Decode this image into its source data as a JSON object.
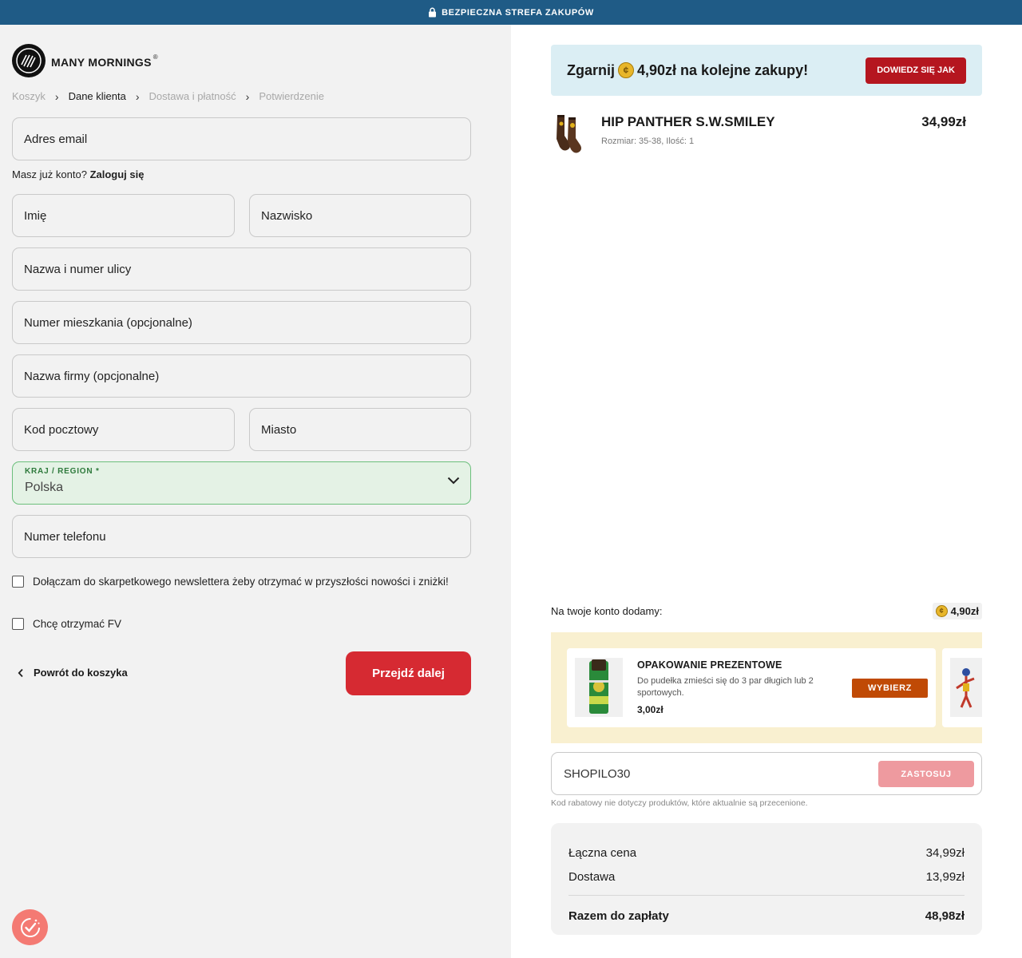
{
  "topbar": {
    "text": "BEZPIECZNA STREFA ZAKUPÓW",
    "icon": "lock-icon"
  },
  "brand": {
    "name": "MANY MORNINGS",
    "mark": "®"
  },
  "breadcrumb": [
    {
      "label": "Koszyk"
    },
    {
      "label": "Dane klienta"
    },
    {
      "label": "Dostawa i płatność"
    },
    {
      "label": "Potwierdzenie"
    }
  ],
  "form": {
    "email": "Adres email",
    "have_account": "Masz już konto?",
    "login": "Zaloguj się",
    "first_name": "Imię",
    "last_name": "Nazwisko",
    "street": "Nazwa i numer ulicy",
    "apartment": "Numer mieszkania (opcjonalne)",
    "company": "Nazwa firmy (opcjonalne)",
    "postal": "Kod pocztowy",
    "city": "Miasto",
    "country_label": "KRAJ / REGION *",
    "country_value": "Polska",
    "phone": "Numer telefonu",
    "newsletter": "Dołączam do skarpetkowego newslettera żeby otrzymać w przyszłości nowości i zniżki!",
    "invoice": "Chcę otrzymać FV",
    "back": "Powrót do koszyka",
    "next": "Przejdź dalej"
  },
  "promo": {
    "prefix": "Zgarnij",
    "text": "4,90zł na kolejne zakupy!",
    "button": "DOWIEDZ SIĘ JAK"
  },
  "cart_item": {
    "name": "HIP PANTHER S.W.SMILEY",
    "meta": "Rozmiar: 35-38, Ilość: 1",
    "price": "34,99zł"
  },
  "account_points": {
    "label": "Na twoje konto dodamy:",
    "value": "4,90zł"
  },
  "upsell": {
    "title": "OPAKOWANIE PREZENTOWE",
    "desc": "Do pudełka zmieści się do 3 par długich lub 2 sportowych.",
    "price": "3,00zł",
    "button": "WYBIERZ"
  },
  "coupon": {
    "value": "SHOPILO30",
    "button": "ZASTOSUJ",
    "note": "Kod rabatowy nie dotyczy produktów, które aktualnie są przecenione."
  },
  "summary": {
    "subtotal_label": "Łączna cena",
    "subtotal": "34,99zł",
    "shipping_label": "Dostawa",
    "shipping": "13,99zł",
    "total_label": "Razem do zapłaty",
    "total": "48,98zł"
  },
  "colors": {
    "topbar": "#1f5b86",
    "accent": "#d62a32",
    "promo_btn": "#b5161f",
    "upsell_btn": "#c04a05"
  }
}
